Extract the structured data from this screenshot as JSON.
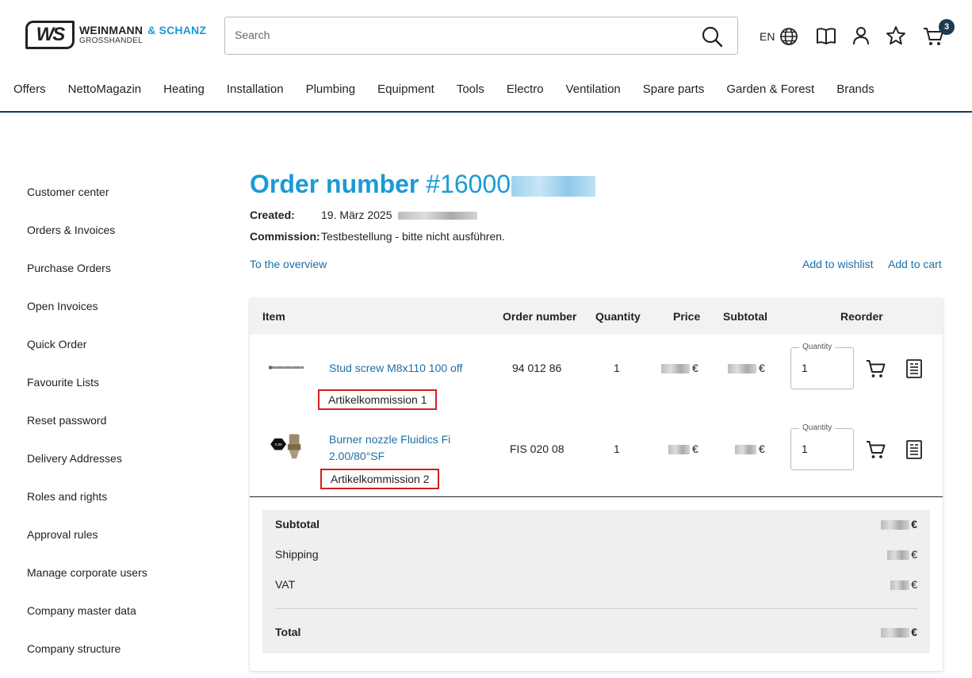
{
  "header": {
    "logo": {
      "mark": "WS",
      "line1": "WEINMANN",
      "line1_accent": "& SCHANZ",
      "line2": "GROSSHANDEL"
    },
    "search": {
      "placeholder": "Search",
      "value": ""
    },
    "language": "EN",
    "cart_count": "3",
    "icons": [
      "globe-icon",
      "catalog-book-icon",
      "account-icon",
      "favourite-star-icon",
      "cart-icon"
    ]
  },
  "nav": [
    "Offers",
    "NettoMagazin",
    "Heating",
    "Installation",
    "Plumbing",
    "Equipment",
    "Tools",
    "Electro",
    "Ventilation",
    "Spare parts",
    "Garden & Forest",
    "Brands"
  ],
  "sidebar": [
    "Customer center",
    "Orders & Invoices",
    "Purchase Orders",
    "Open Invoices",
    "Quick Order",
    "Favourite Lists",
    "Reset password",
    "Delivery Addresses",
    "Roles and rights",
    "Approval rules",
    "Manage corporate users",
    "Company master data",
    "Company structure"
  ],
  "order": {
    "title_prefix": "Order number",
    "number_visible": "#16000",
    "created_label": "Created:",
    "created_value": "19. März 2025",
    "commission_label": "Commission:",
    "commission_value": "Testbestellung - bitte nicht ausführen."
  },
  "links": {
    "overview": "To the overview",
    "wishlist": "Add to wishlist",
    "cart": "Add to cart"
  },
  "table": {
    "headers": {
      "item": "Item",
      "order_number": "Order number",
      "quantity": "Quantity",
      "price": "Price",
      "subtotal": "Subtotal",
      "reorder": "Reorder"
    },
    "rows": [
      {
        "name": "Stud screw M8x110 100 off",
        "order_number": "94 012 86",
        "quantity": "1",
        "price_currency": "€",
        "subtotal_currency": "€",
        "commission": "Artikelkommission 1",
        "qty_label": "Quantity",
        "qty_value": "1"
      },
      {
        "name": "Burner nozzle Fluidics Fi 2.00/80°SF",
        "order_number": "FIS 020 08",
        "quantity": "1",
        "price_currency": "€",
        "subtotal_currency": "€",
        "commission": "Artikelkommission 2",
        "qty_label": "Quantity",
        "qty_value": "1"
      }
    ]
  },
  "totals": {
    "subtotal_label": "Subtotal",
    "subtotal_currency": "€",
    "shipping_label": "Shipping",
    "shipping_currency": "€",
    "vat_label": "VAT",
    "vat_currency": "€",
    "total_label": "Total",
    "total_currency": "€"
  },
  "colors": {
    "brand_blue": "#1a9ad6",
    "link_blue": "#1d6fa5",
    "dark_navy": "#1d3a4f",
    "highlight_red": "#d21e1e"
  }
}
